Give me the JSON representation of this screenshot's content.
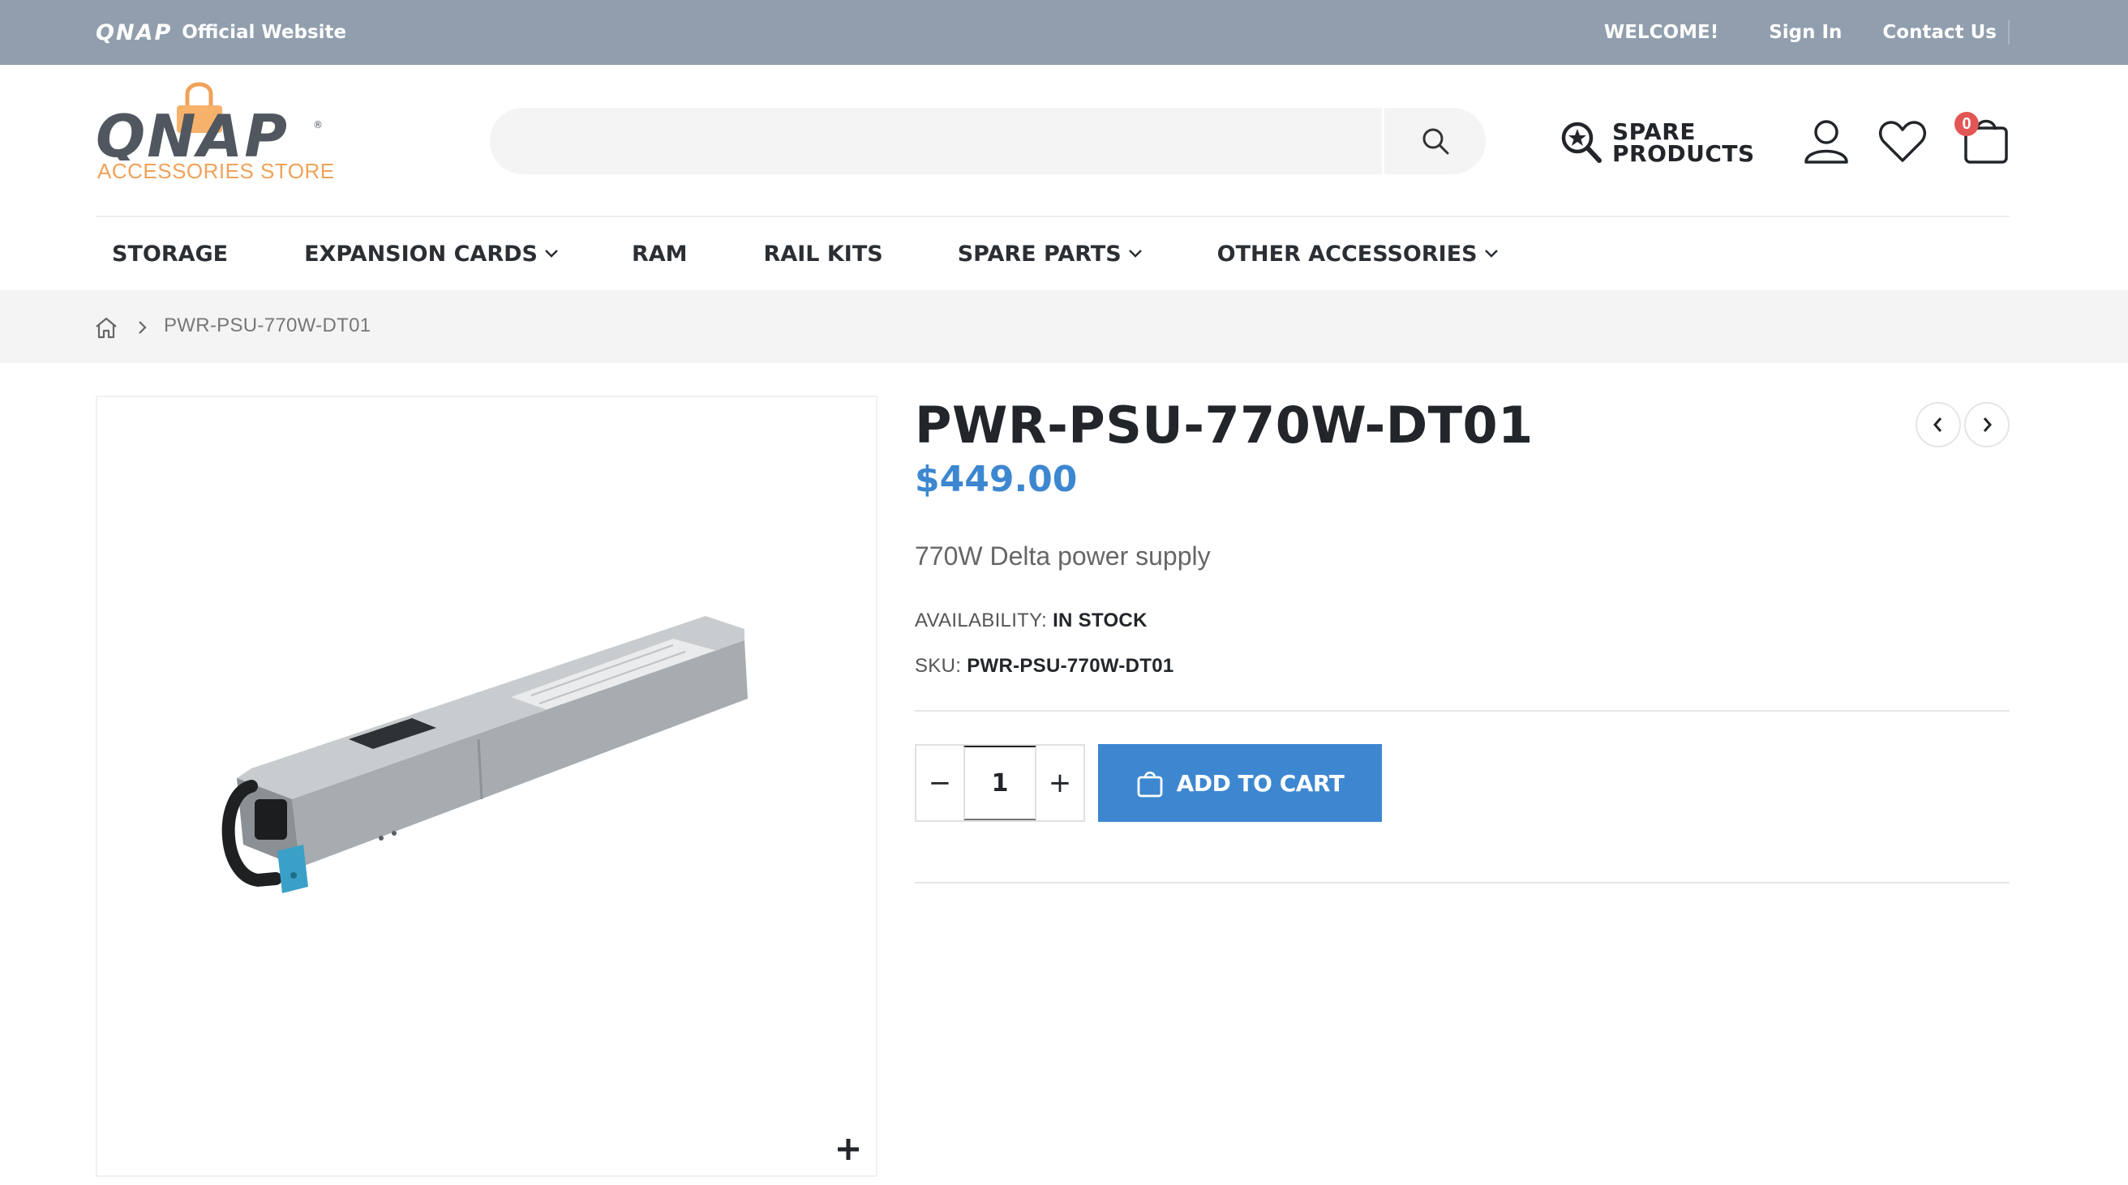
{
  "topbar": {
    "logo": "QNAP",
    "official_label": "Official Website",
    "welcome": "WELCOME!",
    "sign_in": "Sign In",
    "contact": "Contact Us"
  },
  "header": {
    "brand_name": "QNAP",
    "brand_sub": "ACCESSORIES STORE",
    "search_placeholder": "",
    "spare_line1": "SPARE",
    "spare_line2": "PRODUCTS",
    "cart_count": "0"
  },
  "nav": {
    "items": [
      {
        "label": "STORAGE"
      },
      {
        "label": "EXPANSION CARDS"
      },
      {
        "label": "RAM"
      },
      {
        "label": "RAIL KITS"
      },
      {
        "label": "SPARE PARTS"
      },
      {
        "label": "OTHER ACCESSORIES"
      }
    ]
  },
  "breadcrumb": {
    "current": "PWR-PSU-770W-DT01"
  },
  "product": {
    "title": "PWR-PSU-770W-DT01",
    "price": "$449.00",
    "short_description": "770W Delta power supply",
    "availability_label": "AVAILABILITY:",
    "availability_value": "IN STOCK",
    "sku_label": "SKU:",
    "sku_value": "PWR-PSU-770W-DT01",
    "quantity": "1",
    "qty_minus": "−",
    "qty_plus": "+",
    "add_to_cart": "ADD TO CART"
  },
  "colors": {
    "topbar": "#919ead",
    "accent": "#3d87d1",
    "brand_orange": "#f0a25a",
    "badge": "#e35656"
  }
}
